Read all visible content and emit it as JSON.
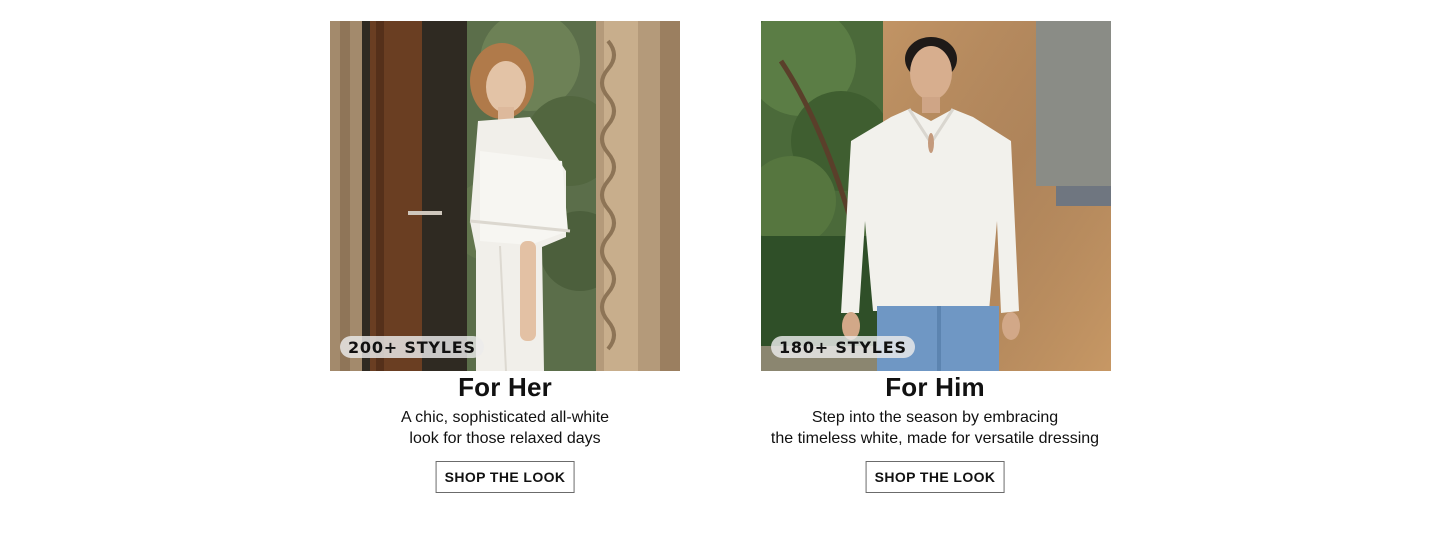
{
  "cards": [
    {
      "title": "For Her",
      "badge": "200+ STYLES",
      "description_lines": [
        "A chic, sophisticated all-white",
        "look for those relaxed days"
      ],
      "cta": "SHOP THE LOOK"
    },
    {
      "title": "For Him",
      "badge": "180+ STYLES",
      "description_lines": [
        "Step into the season by embracing",
        "the timeless white, made for versatile dressing"
      ],
      "cta": "SHOP THE LOOK"
    }
  ]
}
